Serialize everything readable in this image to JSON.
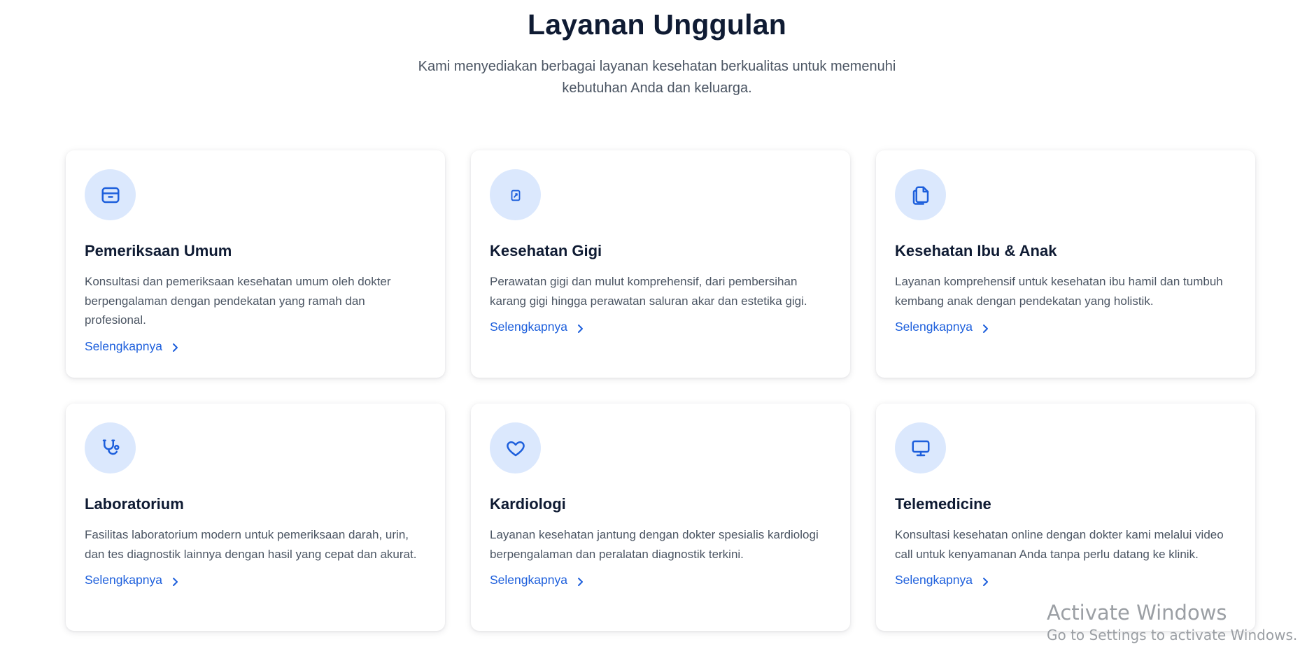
{
  "section": {
    "title": "Layanan Unggulan",
    "subtitle": "Kami menyediakan berbagai layanan kesehatan berkualitas untuk memenuhi kebutuhan Anda dan keluarga."
  },
  "cards": [
    {
      "icon": "box-icon",
      "title": "Pemeriksaan Umum",
      "description": "Konsultasi dan pemeriksaan kesehatan umum oleh dokter berpengalaman dengan pendekatan yang ramah dan profesional.",
      "link": "Selengkapnya"
    },
    {
      "icon": "clipboard-edit-icon",
      "title": "Kesehatan Gigi",
      "description": "Perawatan gigi dan mulut komprehensif, dari pembersihan karang gigi hingga perawatan saluran akar dan estetika gigi.",
      "link": "Selengkapnya"
    },
    {
      "icon": "documents-icon",
      "title": "Kesehatan Ibu & Anak",
      "description": "Layanan komprehensif untuk kesehatan ibu hamil dan tumbuh kembang anak dengan pendekatan yang holistik.",
      "link": "Selengkapnya"
    },
    {
      "icon": "stethoscope-icon",
      "title": "Laboratorium",
      "description": "Fasilitas laboratorium modern untuk pemeriksaan darah, urin, dan tes diagnostik lainnya dengan hasil yang cepat dan akurat.",
      "link": "Selengkapnya"
    },
    {
      "icon": "heart-icon",
      "title": "Kardiologi",
      "description": "Layanan kesehatan jantung dengan dokter spesialis kardiologi berpengalaman dan peralatan diagnostik terkini.",
      "link": "Selengkapnya"
    },
    {
      "icon": "monitor-icon",
      "title": "Telemedicine",
      "description": "Konsultasi kesehatan online dengan dokter kami melalui video call untuk kenyamanan Anda tanpa perlu datang ke klinik.",
      "link": "Selengkapnya"
    }
  ],
  "watermark": {
    "title": "Activate Windows",
    "subtitle": "Go to Settings to activate Windows."
  },
  "colors": {
    "accent": "#1d5fdc",
    "icon_bg": "#dbe8fd",
    "heading": "#0f1b33",
    "body_text": "#4b5563"
  }
}
